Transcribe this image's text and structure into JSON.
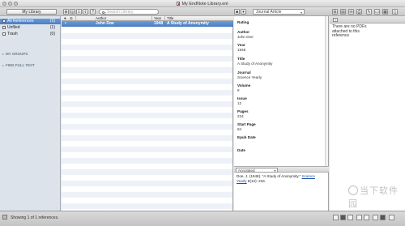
{
  "window": {
    "title": "My EndNote Library.enl"
  },
  "toolbar": {
    "library_select": "My Library",
    "search_placeholder": "Search Library",
    "reference_type": "Journal Article",
    "help_label": "?"
  },
  "sidebar": {
    "items": [
      {
        "label": "All References",
        "count": "(1)",
        "selected": true,
        "icon": "references-icon"
      },
      {
        "label": "Unfiled",
        "count": "(1)",
        "icon": "unfiled-icon"
      },
      {
        "label": "Trash",
        "count": "(0)",
        "icon": "trash-icon"
      }
    ],
    "groups": [
      {
        "label": "MY GROUPS"
      },
      {
        "label": "FIND FULL TEXT"
      }
    ]
  },
  "reference_list": {
    "columns": [
      "Author",
      "Year",
      "Title"
    ],
    "rows": [
      {
        "author": "John Doe",
        "year": "1948",
        "title": "A Study of Anonymity"
      }
    ]
  },
  "reference_panel": {
    "fields": [
      {
        "label": "Rating",
        "value": ""
      },
      {
        "label": "Author",
        "value": "John Doe"
      },
      {
        "label": "Year",
        "value": "1948"
      },
      {
        "label": "Title",
        "value": "A Study of Anonymity"
      },
      {
        "label": "Journal",
        "value": "Science Yearly"
      },
      {
        "label": "Volume",
        "value": "8"
      },
      {
        "label": "Issue",
        "value": "12"
      },
      {
        "label": "Pages",
        "value": "234"
      },
      {
        "label": "Start Page",
        "value": "84"
      },
      {
        "label": "Epub Date",
        "value": ""
      },
      {
        "label": "Date",
        "value": ""
      }
    ]
  },
  "preview": {
    "style": "Annotated",
    "text_a": "Doe, J. (1948). \"A Study of Anonymity.\"",
    "link": "Science Yearly",
    "text_b": "8(12): 234."
  },
  "attachments": {
    "message": "There are no PDFs attached to this reference"
  },
  "status": {
    "text": "Showing 1 of 1 references."
  },
  "watermark": {
    "text": "当下软件园"
  },
  "colors": {
    "selection": "#4a7ec5",
    "sidebar": "#dce3eb"
  }
}
